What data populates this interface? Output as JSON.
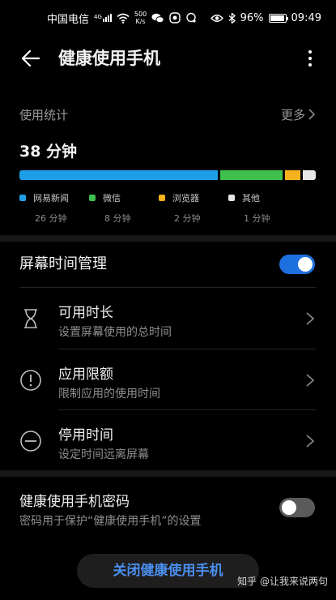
{
  "status_bar": {
    "carrier": "中国电信",
    "signal_tag": "4G",
    "net_speed_value": "500",
    "net_speed_unit": "K/s",
    "battery": "96%",
    "time": "09:49"
  },
  "header": {
    "title": "健康使用手机"
  },
  "usage": {
    "section_label": "使用统计",
    "more_label": "更多",
    "total": "38 分钟",
    "apps": [
      {
        "name": "网易新闻",
        "time": "26 分钟",
        "minutes": 26,
        "color": "#1f9ee8"
      },
      {
        "name": "微信",
        "time": "8 分钟",
        "minutes": 8,
        "color": "#3fbf4c"
      },
      {
        "name": "浏览器",
        "time": "2 分钟",
        "minutes": 2,
        "color": "#f5b21c"
      },
      {
        "name": "其他",
        "time": "1 分钟",
        "minutes": 1,
        "color": "#e6e6e6"
      }
    ]
  },
  "screen_time": {
    "label": "屏幕时间管理",
    "enabled": true,
    "items": [
      {
        "title": "可用时长",
        "subtitle": "设置屏幕使用的总时间",
        "icon": "hourglass-icon"
      },
      {
        "title": "应用限额",
        "subtitle": "限制应用的使用时间",
        "icon": "exclamation-circle-icon"
      },
      {
        "title": "停用时间",
        "subtitle": "设定时间远离屏幕",
        "icon": "minus-circle-icon"
      }
    ]
  },
  "password": {
    "title": "健康使用手机密码",
    "subtitle": "密码用于保护“健康使用手机”的设置",
    "enabled": false
  },
  "close_button": "关闭健康使用手机",
  "watermark": "知乎 @让我来说两句",
  "colors": {
    "accent": "#1e6fe0",
    "toggle_off": "#5a5a5a"
  }
}
